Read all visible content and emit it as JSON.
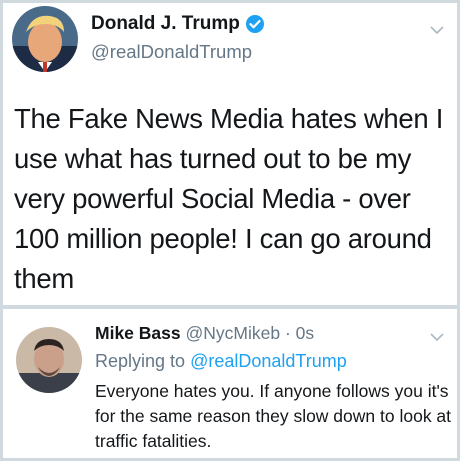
{
  "tweet": {
    "author_name": "Donald J. Trump",
    "author_handle": "@realDonaldTrump",
    "verified": true,
    "text": "The Fake News Media hates when I use what has turned out to be my very powerful Social Media - over 100 million people! I can go around them"
  },
  "reply": {
    "author_name": "Mike Bass",
    "author_handle": "@NycMikeb",
    "separator": "·",
    "time": "0s",
    "replying_prefix": "Replying to",
    "replying_mention": "@realDonaldTrump",
    "text": "Everyone hates you. If anyone follows you it's for the same reason they slow down to look at traffic fatalities."
  },
  "colors": {
    "text": "#14171a",
    "secondary": "#657786",
    "accent": "#1da1f2",
    "verified_badge": "#1da1f2"
  },
  "icons": [
    "avatar-trump",
    "verified-badge-icon",
    "chevron-down-icon",
    "avatar-mike"
  ]
}
